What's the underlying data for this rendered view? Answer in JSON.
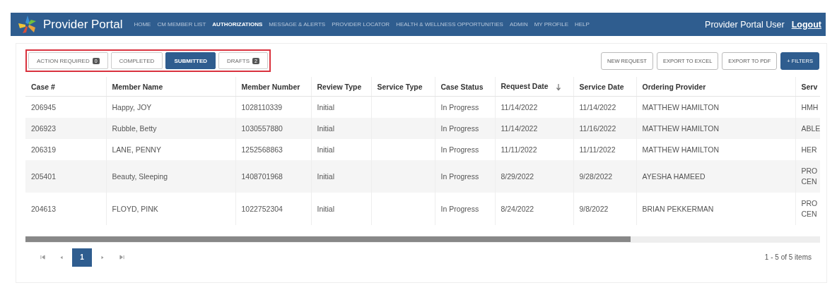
{
  "header": {
    "title": "Provider Portal",
    "nav": [
      {
        "label": "HOME",
        "selected": false
      },
      {
        "label": "CM MEMBER LIST",
        "selected": false
      },
      {
        "label": "AUTHORIZATIONS",
        "selected": true
      },
      {
        "label": "MESSAGE & ALERTS",
        "selected": false
      },
      {
        "label": "PROVIDER LOCATOR",
        "selected": false
      },
      {
        "label": "HEALTH & WELLNESS OPPORTUNITIES",
        "selected": false
      },
      {
        "label": "ADMIN",
        "selected": false
      },
      {
        "label": "MY PROFILE",
        "selected": false
      },
      {
        "label": "HELP",
        "selected": false
      }
    ],
    "user": "Provider Portal User",
    "logout": "Logout"
  },
  "tabs": [
    {
      "label": "ACTION REQUIRED",
      "badge": "0",
      "selected": false
    },
    {
      "label": "COMPLETED",
      "selected": false
    },
    {
      "label": "SUBMITTED",
      "selected": true
    },
    {
      "label": "DRAFTS",
      "badge": "2",
      "selected": false
    }
  ],
  "actions": [
    {
      "label": "NEW REQUEST",
      "kind": "outline"
    },
    {
      "label": "EXPORT TO EXCEL",
      "kind": "outline"
    },
    {
      "label": "EXPORT TO PDF",
      "kind": "outline"
    },
    {
      "label": "+ FILTERS",
      "kind": "primary"
    }
  ],
  "table": {
    "columns": [
      {
        "label": "Case #"
      },
      {
        "label": "Member Name"
      },
      {
        "label": "Member Number"
      },
      {
        "label": "Review Type"
      },
      {
        "label": "Service Type"
      },
      {
        "label": "Case Status"
      },
      {
        "label": "Request Date",
        "sorted": true
      },
      {
        "label": "Service Date"
      },
      {
        "label": "Ordering Provider"
      },
      {
        "label": "Serv"
      }
    ],
    "rows": [
      [
        "206945",
        "Happy, JOY",
        "1028110339",
        "Initial",
        "",
        "In Progress",
        "11/14/2022",
        "11/14/2022",
        "MATTHEW HAMILTON",
        "HMH"
      ],
      [
        "206923",
        "Rubble, Betty",
        "1030557880",
        "Initial",
        "",
        "In Progress",
        "11/14/2022",
        "11/16/2022",
        "MATTHEW HAMILTON",
        "ABLE"
      ],
      [
        "206319",
        "LANE, PENNY",
        "1252568863",
        "Initial",
        "",
        "In Progress",
        "11/11/2022",
        "11/11/2022",
        "MATTHEW HAMILTON",
        "HER"
      ],
      [
        "205401",
        "Beauty, Sleeping",
        "1408701968",
        "Initial",
        "",
        "In Progress",
        "8/29/2022",
        "9/28/2022",
        "AYESHA HAMEED",
        "PRO CEN"
      ],
      [
        "204613",
        "FLOYD, PINK",
        "1022752304",
        "Initial",
        "",
        "In Progress",
        "8/24/2022",
        "9/8/2022",
        "BRIAN PEKKERMAN",
        "PRO CEN"
      ]
    ]
  },
  "pager": {
    "pages": [
      {
        "label": "1",
        "selected": true
      }
    ],
    "summary": "1 - 5 of 5 items"
  }
}
